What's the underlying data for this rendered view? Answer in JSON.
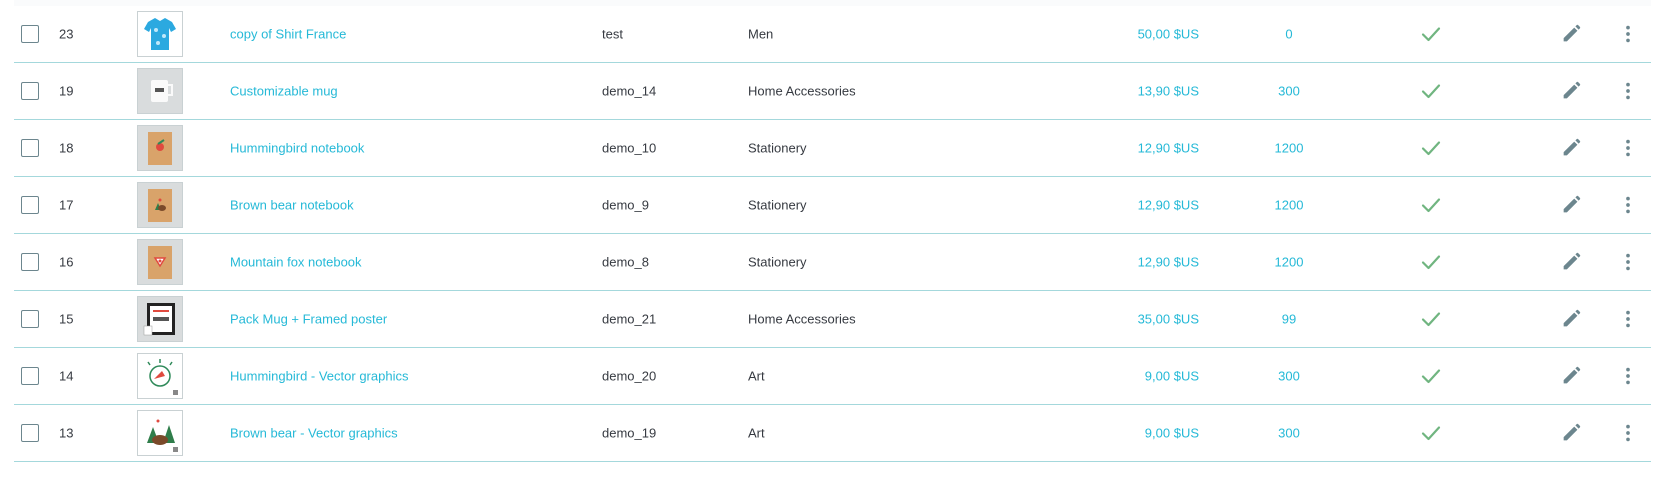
{
  "colors": {
    "link": "#25b9d7",
    "check": "#70b580",
    "row_border": "#a4d8dc",
    "icon": "#6c868e"
  },
  "icons": {
    "status": "check-icon",
    "edit": "pencil-icon",
    "more": "kebab-menu-icon"
  },
  "products": [
    {
      "id": "23",
      "thumb": "shirt",
      "name": "copy of Shirt France",
      "reference": "test",
      "category": "Men",
      "price": "50,00 $US",
      "quantity": "0",
      "active": true
    },
    {
      "id": "19",
      "thumb": "mug",
      "name": "Customizable mug",
      "reference": "demo_14",
      "category": "Home Accessories",
      "price": "13,90 $US",
      "quantity": "300",
      "active": true
    },
    {
      "id": "18",
      "thumb": "notebook-hummingbird",
      "name": "Hummingbird notebook",
      "reference": "demo_10",
      "category": "Stationery",
      "price": "12,90 $US",
      "quantity": "1200",
      "active": true
    },
    {
      "id": "17",
      "thumb": "notebook-bear",
      "name": "Brown bear notebook",
      "reference": "demo_9",
      "category": "Stationery",
      "price": "12,90 $US",
      "quantity": "1200",
      "active": true
    },
    {
      "id": "16",
      "thumb": "notebook-fox",
      "name": "Mountain fox notebook",
      "reference": "demo_8",
      "category": "Stationery",
      "price": "12,90 $US",
      "quantity": "1200",
      "active": true
    },
    {
      "id": "15",
      "thumb": "poster-pack",
      "name": "Pack Mug + Framed poster",
      "reference": "demo_21",
      "category": "Home Accessories",
      "price": "35,00 $US",
      "quantity": "99",
      "active": true
    },
    {
      "id": "14",
      "thumb": "vector-hummingbird",
      "name": "Hummingbird - Vector graphics",
      "reference": "demo_20",
      "category": "Art",
      "price": "9,00 $US",
      "quantity": "300",
      "active": true
    },
    {
      "id": "13",
      "thumb": "vector-bear",
      "name": "Brown bear - Vector graphics",
      "reference": "demo_19",
      "category": "Art",
      "price": "9,00 $US",
      "quantity": "300",
      "active": true
    }
  ]
}
